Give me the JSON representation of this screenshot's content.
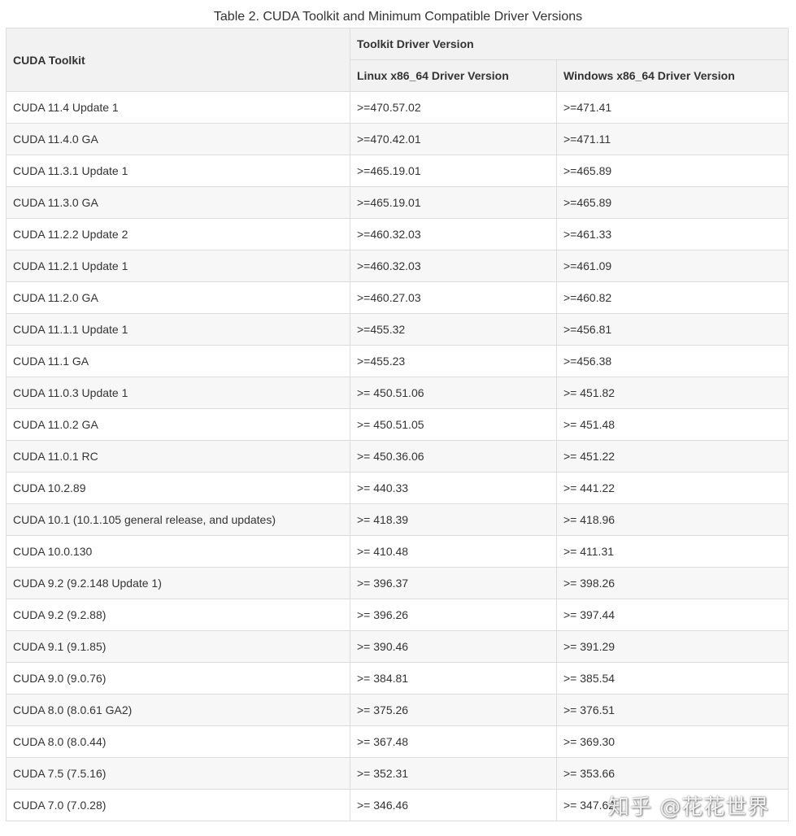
{
  "caption": "Table 2. CUDA Toolkit and Minimum Compatible Driver Versions",
  "table": {
    "header": {
      "toolkit": "CUDA Toolkit",
      "group": "Toolkit Driver Version",
      "linux": "Linux x86_64 Driver Version",
      "windows": "Windows x86_64 Driver Version"
    },
    "rows": [
      {
        "toolkit": "CUDA 11.4 Update 1",
        "linux": ">=470.57.02",
        "windows": ">=471.41"
      },
      {
        "toolkit": "CUDA 11.4.0 GA",
        "linux": ">=470.42.01",
        "windows": ">=471.11"
      },
      {
        "toolkit": "CUDA 11.3.1 Update 1",
        "linux": ">=465.19.01",
        "windows": ">=465.89"
      },
      {
        "toolkit": "CUDA 11.3.0 GA",
        "linux": ">=465.19.01",
        "windows": ">=465.89"
      },
      {
        "toolkit": "CUDA 11.2.2 Update 2",
        "linux": ">=460.32.03",
        "windows": ">=461.33"
      },
      {
        "toolkit": "CUDA 11.2.1 Update 1",
        "linux": ">=460.32.03",
        "windows": ">=461.09"
      },
      {
        "toolkit": "CUDA 11.2.0 GA",
        "linux": ">=460.27.03",
        "windows": ">=460.82"
      },
      {
        "toolkit": "CUDA 11.1.1 Update 1",
        "linux": ">=455.32",
        "windows": ">=456.81"
      },
      {
        "toolkit": "CUDA 11.1 GA",
        "linux": ">=455.23",
        "windows": ">=456.38"
      },
      {
        "toolkit": "CUDA 11.0.3 Update 1",
        "linux": ">= 450.51.06",
        "windows": ">= 451.82"
      },
      {
        "toolkit": "CUDA 11.0.2 GA",
        "linux": ">= 450.51.05",
        "windows": ">= 451.48"
      },
      {
        "toolkit": "CUDA 11.0.1 RC",
        "linux": ">= 450.36.06",
        "windows": ">= 451.22"
      },
      {
        "toolkit": "CUDA 10.2.89",
        "linux": ">= 440.33",
        "windows": ">= 441.22"
      },
      {
        "toolkit": "CUDA 10.1 (10.1.105 general release, and updates)",
        "linux": ">= 418.39",
        "windows": ">= 418.96"
      },
      {
        "toolkit": "CUDA 10.0.130",
        "linux": ">= 410.48",
        "windows": ">= 411.31"
      },
      {
        "toolkit": "CUDA 9.2 (9.2.148 Update 1)",
        "linux": ">= 396.37",
        "windows": ">= 398.26"
      },
      {
        "toolkit": "CUDA 9.2 (9.2.88)",
        "linux": ">= 396.26",
        "windows": ">= 397.44"
      },
      {
        "toolkit": "CUDA 9.1 (9.1.85)",
        "linux": ">= 390.46",
        "windows": ">= 391.29"
      },
      {
        "toolkit": "CUDA 9.0 (9.0.76)",
        "linux": ">= 384.81",
        "windows": ">= 385.54"
      },
      {
        "toolkit": "CUDA 8.0 (8.0.61 GA2)",
        "linux": ">= 375.26",
        "windows": ">= 376.51"
      },
      {
        "toolkit": "CUDA 8.0 (8.0.44)",
        "linux": ">= 367.48",
        "windows": ">= 369.30"
      },
      {
        "toolkit": "CUDA 7.5 (7.5.16)",
        "linux": ">= 352.31",
        "windows": ">= 353.66"
      },
      {
        "toolkit": "CUDA 7.0 (7.0.28)",
        "linux": ">= 346.46",
        "windows": ">= 347.62"
      }
    ]
  },
  "watermark": "知乎 @花花世界"
}
